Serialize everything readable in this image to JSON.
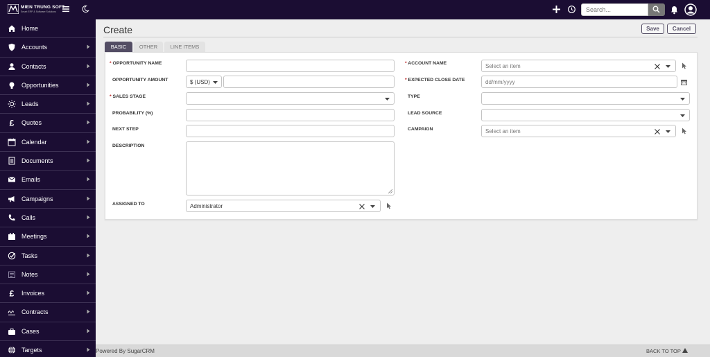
{
  "brand": {
    "name": "MIEN TRUNG SOFT",
    "tagline": "Smart ERP & Software Solutions"
  },
  "topbar": {
    "search_placeholder": "Search..."
  },
  "sidebar": {
    "items": [
      {
        "label": "Home",
        "icon": "home-icon",
        "has_submenu": false
      },
      {
        "label": "Accounts",
        "icon": "shield-icon",
        "has_submenu": true
      },
      {
        "label": "Contacts",
        "icon": "person-icon",
        "has_submenu": true
      },
      {
        "label": "Opportunities",
        "icon": "lightbulb-icon",
        "has_submenu": true
      },
      {
        "label": "Leads",
        "icon": "sun-icon",
        "has_submenu": true
      },
      {
        "label": "Quotes",
        "icon": "pound-icon",
        "has_submenu": true
      },
      {
        "label": "Calendar",
        "icon": "calendar-icon",
        "has_submenu": true
      },
      {
        "label": "Documents",
        "icon": "document-icon",
        "has_submenu": true
      },
      {
        "label": "Emails",
        "icon": "envelope-icon",
        "has_submenu": true
      },
      {
        "label": "Campaigns",
        "icon": "megaphone-icon",
        "has_submenu": true
      },
      {
        "label": "Calls",
        "icon": "phone-icon",
        "has_submenu": true
      },
      {
        "label": "Meetings",
        "icon": "meetings-icon",
        "has_submenu": true
      },
      {
        "label": "Tasks",
        "icon": "check-icon",
        "has_submenu": true
      },
      {
        "label": "Notes",
        "icon": "note-icon",
        "has_submenu": true
      },
      {
        "label": "Invoices",
        "icon": "pound-icon",
        "has_submenu": true
      },
      {
        "label": "Contracts",
        "icon": "signature-icon",
        "has_submenu": true
      },
      {
        "label": "Cases",
        "icon": "cases-icon",
        "has_submenu": true
      },
      {
        "label": "Targets",
        "icon": "globe-icon",
        "has_submenu": true
      }
    ]
  },
  "page": {
    "title": "Create"
  },
  "actions": {
    "save": "Save",
    "cancel": "Cancel"
  },
  "tabs": [
    {
      "label": "BASIC",
      "active": true
    },
    {
      "label": "OTHER",
      "active": false
    },
    {
      "label": "LINE ITEMS",
      "active": false
    }
  ],
  "form": {
    "opportunity_name": {
      "label": "OPPORTUNITY NAME",
      "required": true,
      "value": ""
    },
    "opportunity_amount": {
      "label": "OPPORTUNITY AMOUNT",
      "currency": "$ (USD)",
      "value": ""
    },
    "sales_stage": {
      "label": "SALES STAGE",
      "required": true,
      "value": ""
    },
    "probability": {
      "label": "PROBABILITY (%)",
      "value": ""
    },
    "next_step": {
      "label": "NEXT STEP",
      "value": ""
    },
    "description": {
      "label": "DESCRIPTION",
      "value": ""
    },
    "assigned_to": {
      "label": "ASSIGNED TO",
      "value": "Administrator"
    },
    "account_name": {
      "label": "ACCOUNT NAME",
      "required": true,
      "placeholder": "Select an item"
    },
    "expected_close_date": {
      "label": "EXPECTED CLOSE DATE",
      "required": true,
      "placeholder": "dd/mm/yyyy"
    },
    "type": {
      "label": "TYPE",
      "value": ""
    },
    "lead_source": {
      "label": "LEAD SOURCE",
      "value": ""
    },
    "campaign": {
      "label": "CAMPAIGN",
      "placeholder": "Select an item"
    }
  },
  "footer": {
    "powered_by": "Powered By SugarCRM",
    "back_to_top": "BACK TO TOP"
  },
  "colors": {
    "sidebar_bg": "#1b0d33",
    "accent": "#534d64",
    "required": "#b91a1a"
  }
}
